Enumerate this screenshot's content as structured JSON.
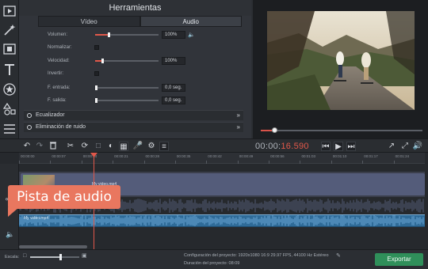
{
  "panel": {
    "title": "Herramientas",
    "tabs": [
      "Vídeo",
      "Audio"
    ],
    "volume": {
      "label": "Volumen:",
      "value": "100%",
      "level": 0.2
    },
    "normalize": {
      "label": "Normalizar:"
    },
    "speed": {
      "label": "Velocidad:",
      "value": "100%",
      "level": 0.1
    },
    "invert": {
      "label": "Invertir:"
    },
    "fade_in": {
      "label": "F. entrada:",
      "value": "0,0 seg."
    },
    "fade_out": {
      "label": "F. salida:",
      "value": "0,0 seg."
    },
    "sections": [
      "Ecualizador",
      "Eliminación de ruido"
    ]
  },
  "preview": {
    "seek_progress": 0.07
  },
  "toolbar": {
    "timecode_gray": "00:00:",
    "timecode_red": "16.590"
  },
  "timeline": {
    "ruler": [
      "00:00:00",
      "00:00:07",
      "00:00:14",
      "00:00:21",
      "00:00:28",
      "00:00:35",
      "00:00:42",
      "00:00:49",
      "00:00:56",
      "00:01:03",
      "00:01:10",
      "00:01:17",
      "00:01:24"
    ],
    "video_clip_label": "My video.mp4",
    "audio_clip_label": "My video.mp4"
  },
  "callout": {
    "text": "Pista de audio"
  },
  "status": {
    "scale_label": "Escala:",
    "scale_level": 0.6,
    "config": "Configuración del proyecto:  1920x1080 16:9 29.97 FPS, 44100 Hz Estéreo",
    "duration": "Duración del proyecto:        08:09",
    "export_label": "Exportar"
  },
  "colors": {
    "accent": "#e0584a",
    "export": "#2f8f5a",
    "callout": "#e9775f",
    "audio": "#2f6b98"
  }
}
